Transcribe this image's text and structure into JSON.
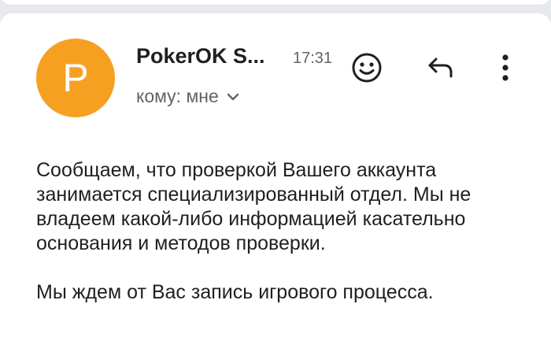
{
  "message": {
    "avatar_letter": "P",
    "sender": "PokerOK S...",
    "time": "17:31",
    "recipient": "кому: мне",
    "colors": {
      "avatar": "#f6a022",
      "text": "#1f1f1f",
      "secondary": "#5f6368"
    },
    "icons": {
      "react": "smiley-icon",
      "reply": "reply-icon",
      "more": "more-vert-icon",
      "details": "chevron-down-icon"
    },
    "body": [
      "Сообщаем, что проверкой Вашего аккаунта занимается специализированный отдел. Мы не владеем какой-либо информацией касательно основания и методов проверки.",
      "Мы ждем от Вас запись игрового процесса."
    ]
  }
}
